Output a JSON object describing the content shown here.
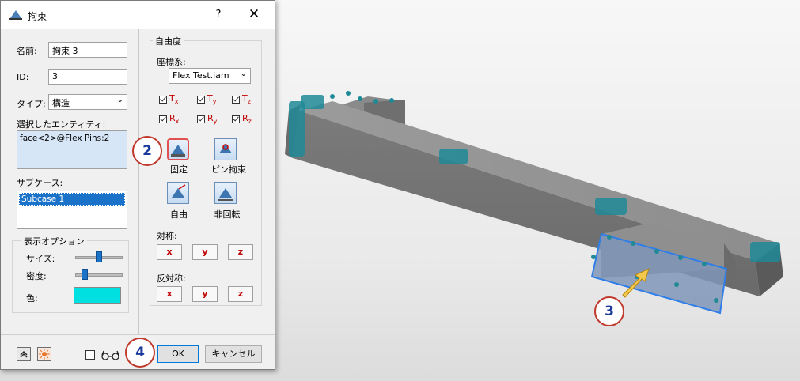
{
  "dialog": {
    "title": "拘束",
    "help": "?",
    "close": "✕",
    "name_label": "名前:",
    "name_value": "拘束 3",
    "id_label": "ID:",
    "id_value": "3",
    "type_label": "タイプ:",
    "type_value": "構造",
    "entity_label": "選択したエンティティ:",
    "entity_value": "face<2>@Flex Pins:2",
    "subcase_label": "サブケース:",
    "subcase_item": "Subcase 1",
    "display_legend": "表示オプション",
    "size_label": "サイズ:",
    "size_level": 0.45,
    "density_label": "密度:",
    "density_level": 0.15,
    "color_label": "色:",
    "color_value": "#00e0e0",
    "dof_legend": "自由度",
    "coord_label": "座標系:",
    "coord_value": "Flex Test.iam",
    "dof_checks": [
      {
        "letter": "T",
        "sub": "x",
        "checked": true
      },
      {
        "letter": "T",
        "sub": "y",
        "checked": true
      },
      {
        "letter": "T",
        "sub": "z",
        "checked": true
      },
      {
        "letter": "R",
        "sub": "x",
        "checked": true
      },
      {
        "letter": "R",
        "sub": "y",
        "checked": true
      },
      {
        "letter": "R",
        "sub": "z",
        "checked": true
      }
    ],
    "fixed_label": "固定",
    "pin_label": "ピン拘束",
    "free_label": "自由",
    "norotate_label": "非回転",
    "sym_label": "対称:",
    "antisym_label": "反対称:",
    "axes": [
      "x",
      "y",
      "z"
    ],
    "ok_label": "OK",
    "cancel_label": "キャンセル"
  },
  "callouts": [
    "2",
    "3",
    "4"
  ],
  "colors": {
    "accent": "#1a73c9",
    "callout_border": "#c0392b",
    "callout_text": "#1a3a9c",
    "constraint": "#1f8a96"
  }
}
